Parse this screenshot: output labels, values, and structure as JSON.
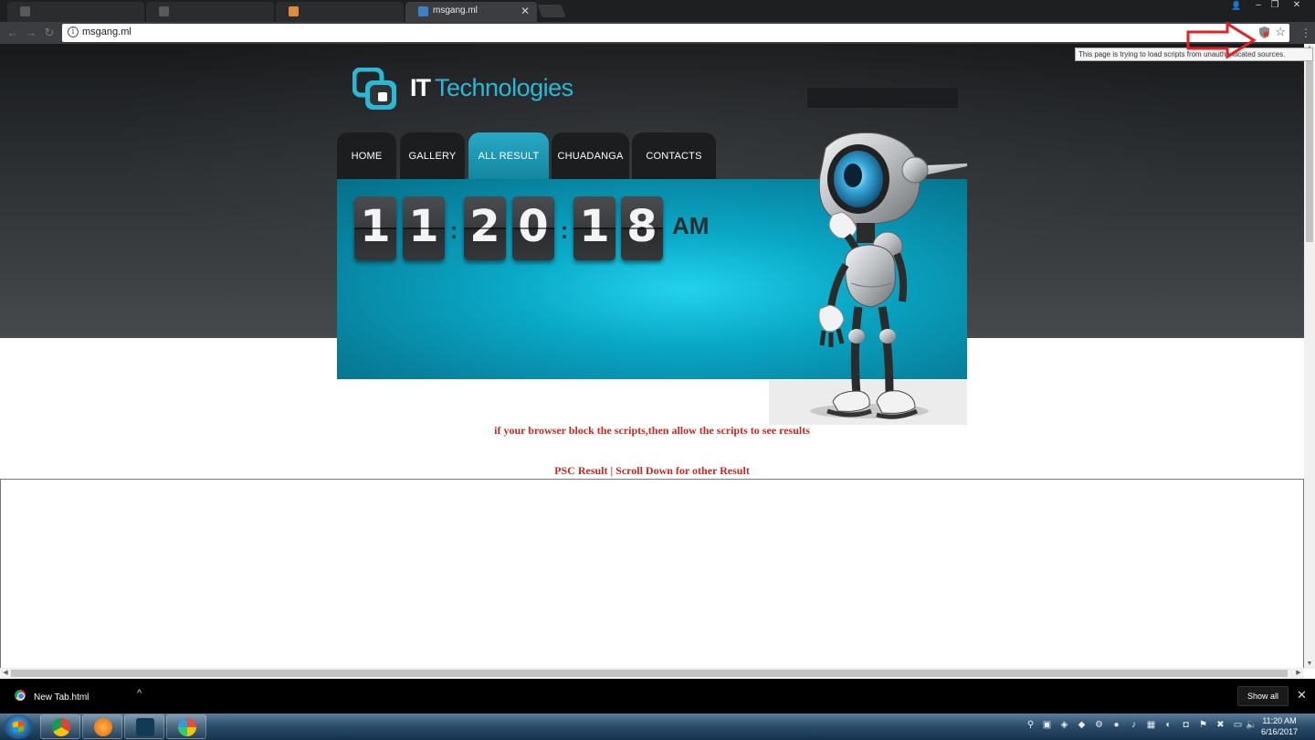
{
  "browser": {
    "tabs": [
      {
        "label": "",
        "active": false
      },
      {
        "label": "",
        "active": false
      },
      {
        "label": "",
        "active": false
      },
      {
        "label": "msgang.ml",
        "active": true
      }
    ],
    "tab_close": "✕",
    "url": "msgang.ml",
    "info_glyph": "i",
    "bookmark_glyph": "☆",
    "menu_glyph": "⋮",
    "tooltip": "This page is trying to load scripts from unauthenticated sources.",
    "window_controls": [
      "–",
      "❐",
      "✕"
    ],
    "profile_glyph": "👤"
  },
  "site": {
    "logo_it": "IT",
    "logo_tech": "Technologies",
    "nav": [
      "HOME",
      "GALLERY",
      "ALL RESULT",
      "CHUADANGA",
      "CONTACTS"
    ],
    "active_nav": "ALL RESULT",
    "clock": {
      "digits": [
        "1",
        "1",
        "2",
        "0",
        "1",
        "8"
      ],
      "separator": ":",
      "ampm": "AM"
    },
    "notice": "if your browser block the scripts,then allow the scripts to see results",
    "psc_line": "PSC Result | Scroll Down for other Result"
  },
  "downloads": {
    "file": "New Tab.html",
    "caret": "^",
    "show_all": "Show all",
    "close": "✕"
  },
  "taskbar": {
    "time": "11:20 AM",
    "date": "6/16/2017",
    "pinned": [
      "chrome-icon",
      "uc-browser-icon",
      "app-icon",
      "photos-icon"
    ]
  },
  "colors": {
    "accent": "#1b8fa9",
    "logo_blue": "#2ab8d2",
    "notice_red": "#c8281e",
    "arrow_red": "#e02222"
  }
}
